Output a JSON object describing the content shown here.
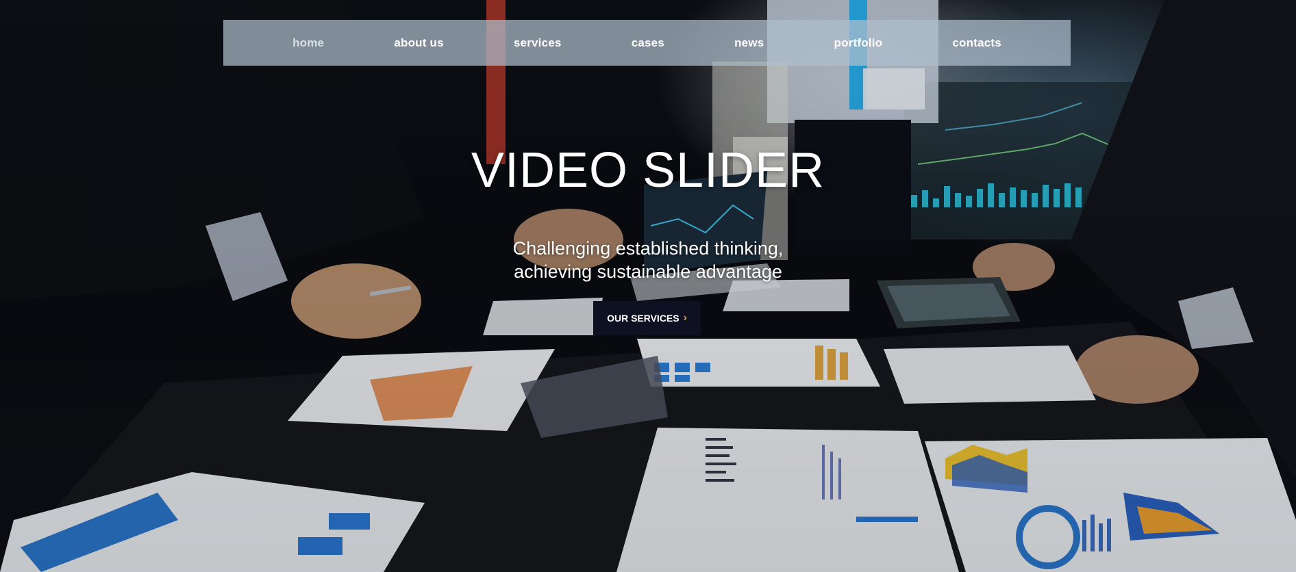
{
  "nav": {
    "items": [
      {
        "label": "home",
        "active": true
      },
      {
        "label": "about us"
      },
      {
        "label": "services"
      },
      {
        "label": "cases"
      },
      {
        "label": "news"
      },
      {
        "label": "portfolio"
      },
      {
        "label": "contacts"
      }
    ]
  },
  "hero": {
    "title": "VIDEO SLIDER",
    "subtitle_line1": "Challenging established thinking,",
    "subtitle_line2": "achieving sustainable advantage",
    "cta_label": "OUR SERVICES",
    "cta_icon": "chevron-right-icon"
  },
  "colors": {
    "nav_bg": "#afbecd",
    "cta_bg": "#0e1122",
    "cta_chevron": "#d9a25a",
    "text": "#ffffff"
  },
  "background": {
    "type": "video",
    "scene_icon": "business-meeting-video"
  }
}
